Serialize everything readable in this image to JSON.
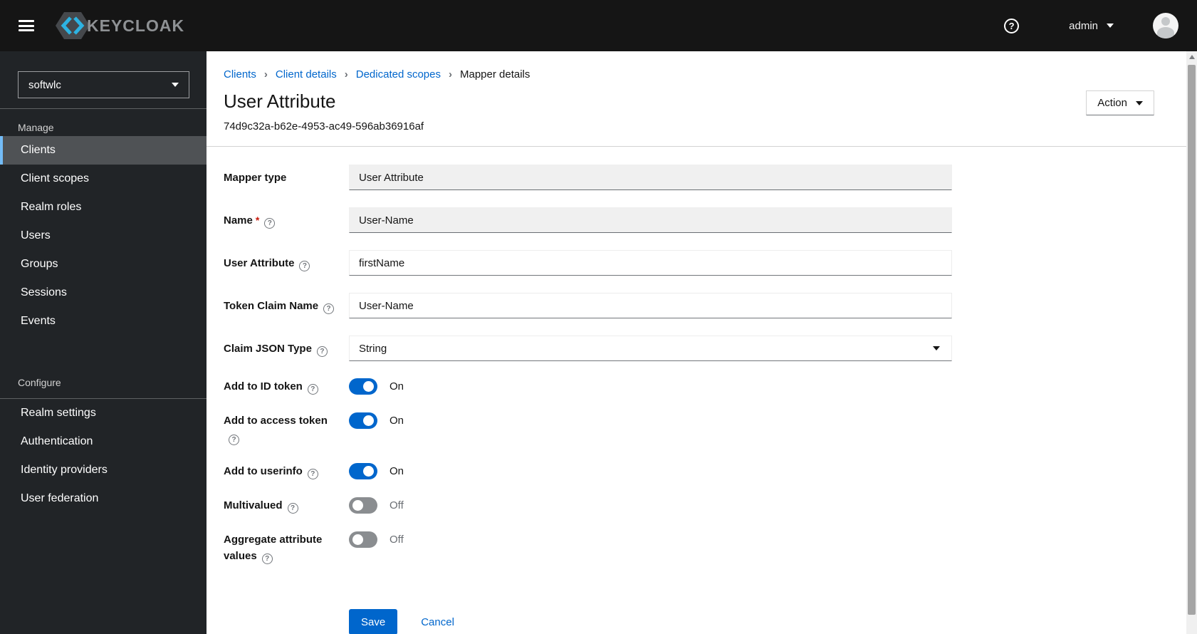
{
  "masthead": {
    "brand": "KEYCLOAK",
    "username": "admin"
  },
  "icons": {
    "menu-icon": "hamburger (three bars)",
    "help-icon": "?",
    "caret-down-icon": "▾",
    "breadcrumb-separator": "›",
    "field-help-icon": "?",
    "required-marker": "*",
    "avatar-icon": "person silhouette",
    "scroll-up-icon": "▲"
  },
  "sidebar": {
    "realm": "softwlc",
    "groups": [
      {
        "label": "Manage",
        "selected": "Clients",
        "items": [
          "Clients",
          "Client scopes",
          "Realm roles",
          "Users",
          "Groups",
          "Sessions",
          "Events"
        ]
      },
      {
        "label": "Configure",
        "selected": "",
        "items": [
          "Realm settings",
          "Authentication",
          "Identity providers",
          "User federation"
        ]
      }
    ]
  },
  "breadcrumb": [
    {
      "label": "Clients",
      "link": true
    },
    {
      "label": "Client details",
      "link": true
    },
    {
      "label": "Dedicated scopes",
      "link": true
    },
    {
      "label": "Mapper details",
      "link": false
    }
  ],
  "page": {
    "title": "User Attribute",
    "subtitle": "74d9c32a-b62e-4953-ac49-596ab36916af",
    "action_label": "Action"
  },
  "form": {
    "fields": [
      {
        "label": "Mapper type",
        "type": "readonly",
        "value": "User Attribute",
        "required": false,
        "help": false
      },
      {
        "label": "Name",
        "type": "readonly",
        "value": "User-Name",
        "required": true,
        "help": true
      },
      {
        "label": "User Attribute",
        "type": "text",
        "value": "firstName",
        "required": false,
        "help": true
      },
      {
        "label": "Token Claim Name",
        "type": "text",
        "value": "User-Name",
        "required": false,
        "help": true
      },
      {
        "label": "Claim JSON Type",
        "type": "select",
        "value": "String",
        "required": false,
        "help": true
      },
      {
        "label": "Add to ID token",
        "type": "toggle",
        "on": true,
        "state_label": "On",
        "help": true
      },
      {
        "label": "Add to access token",
        "type": "toggle",
        "on": true,
        "state_label": "On",
        "help": true
      },
      {
        "label": "Add to userinfo",
        "type": "toggle",
        "on": true,
        "state_label": "On",
        "help": true
      },
      {
        "label": "Multivalued",
        "type": "toggle",
        "on": false,
        "state_label": "Off",
        "help": true
      },
      {
        "label": "Aggregate attribute values",
        "type": "toggle",
        "on": false,
        "state_label": "Off",
        "help": true
      }
    ],
    "actions": {
      "save": "Save",
      "cancel": "Cancel"
    }
  },
  "colors": {
    "accent": "#0066cc",
    "link": "#0066cc",
    "toggle_on": "#0066cc",
    "toggle_off": "#8a8d90",
    "masthead_bg": "#151515",
    "sidebar_bg": "#212427",
    "nav_selected_accent": "#73bcf7",
    "brand_cyan": "#2db3e2"
  }
}
